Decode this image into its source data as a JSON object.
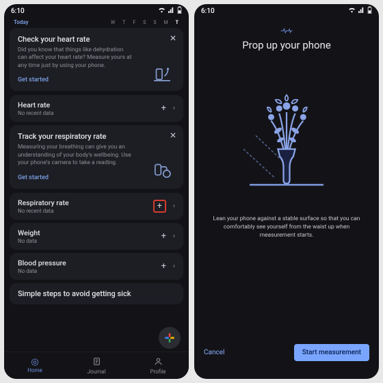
{
  "status": {
    "time": "6:10"
  },
  "left": {
    "today_label": "Today",
    "days": [
      "W",
      "T",
      "F",
      "S",
      "S",
      "M",
      "T"
    ],
    "promo_heart": {
      "title": "Check your heart rate",
      "desc": "Did you know that things like dehydration can affect your heart rate? Measure yours at any time just by using your phone.",
      "link": "Get started"
    },
    "rows": {
      "heart": {
        "title": "Heart rate",
        "sub": "No recent data"
      },
      "resp": {
        "title": "Respiratory rate",
        "sub": "No recent data"
      },
      "weight": {
        "title": "Weight",
        "sub": "No data"
      },
      "bp": {
        "title": "Blood pressure",
        "sub": "No data"
      }
    },
    "promo_resp": {
      "title": "Track your respiratory rate",
      "desc": "Measuring your breathing can give you an understanding of your body's wellbeing. Use your phone's camera to take a reading.",
      "link": "Get started"
    },
    "tips_title": "Simple steps to avoid getting sick",
    "nav": {
      "home": "Home",
      "journal": "Journal",
      "profile": "Profile"
    }
  },
  "right": {
    "title": "Prop up your phone",
    "caption": "Lean your phone against a stable surface so that you can comfortably see yourself from the waist up when measurement starts.",
    "cancel": "Cancel",
    "start": "Start measurement"
  }
}
